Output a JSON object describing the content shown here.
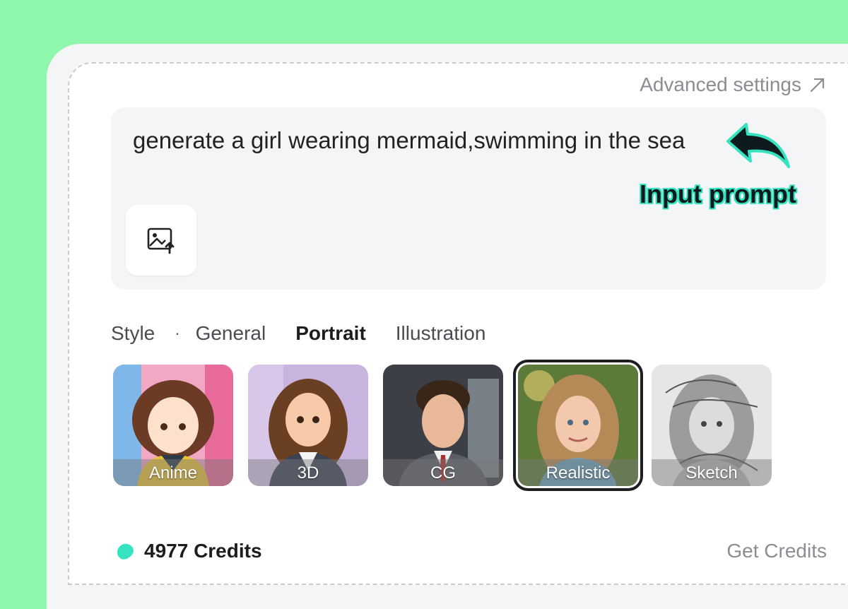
{
  "header": {
    "advanced_settings": "Advanced settings"
  },
  "prompt": {
    "text": "generate a girl wearing mermaid,swimming in the sea"
  },
  "annotation": {
    "label": "Input prompt",
    "color": "#36e3c0"
  },
  "style": {
    "label": "Style",
    "separator": "·",
    "tabs": [
      "General",
      "Portrait",
      "Illustration"
    ],
    "active_tab": "Portrait"
  },
  "cards": [
    {
      "label": "Anime",
      "selected": false
    },
    {
      "label": "3D",
      "selected": false
    },
    {
      "label": "CG",
      "selected": false
    },
    {
      "label": "Realistic",
      "selected": true
    },
    {
      "label": "Sketch",
      "selected": false
    }
  ],
  "footer": {
    "credits": "4977 Credits",
    "get_credits": "Get Credits"
  },
  "colors": {
    "background": "#8ef7ab",
    "accent": "#36e3c0"
  }
}
